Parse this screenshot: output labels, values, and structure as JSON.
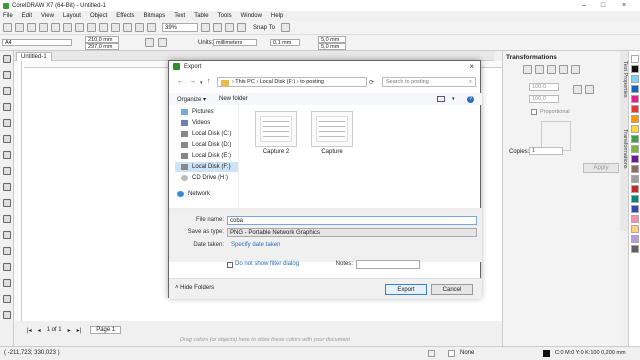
{
  "window": {
    "title": "CorelDRAW X7 (64-Bit) - Untitled-1"
  },
  "menu": [
    "File",
    "Edit",
    "View",
    "Layout",
    "Object",
    "Effects",
    "Bitmaps",
    "Text",
    "Table",
    "Tools",
    "Window",
    "Help"
  ],
  "toolbar": {
    "zoom": "39%",
    "snap": "Snap To"
  },
  "propbar": {
    "paper": "A4",
    "width": "210,0 mm",
    "height": "297,0 mm",
    "units_label": "Units:",
    "units": "millimeters",
    "nudge": "0,1 mm",
    "dup_x": "5,0 mm",
    "dup_y": "5,0 mm"
  },
  "doc": {
    "tab": "Untitled-1",
    "page_pos": "1 of 1",
    "page_tab": "Page 1",
    "hint": "Drag colors (or objects) here to store these colors with your document"
  },
  "status": {
    "coords": "( -211,723; 330,023 )",
    "fill": "None",
    "outline": "C:0 M:0 Y:0 K:100 0,200 mm"
  },
  "docker": {
    "title": "Transformations",
    "x": "100,0",
    "y": "100,0",
    "proportional": "Proportional",
    "copies_label": "Copies:",
    "copies": "1",
    "apply": "Apply",
    "tab1": "Text Properties",
    "tab2": "Transformations"
  },
  "dialog": {
    "title": "Export",
    "path": [
      "This PC",
      "Local Disk (F:)",
      "to posting"
    ],
    "search_placeholder": "Search to posting",
    "organize": "Organize ▾",
    "new_folder": "New folder",
    "nav": [
      "Pictures",
      "Videos",
      "Local Disk (C:)",
      "Local Disk (D:)",
      "Local Disk (E:)",
      "Local Disk (F:)",
      "CD Drive (H:)",
      "Network"
    ],
    "files": [
      "Capture 2",
      "Capture"
    ],
    "file_name_label": "File name:",
    "file_name": "coba",
    "save_type_label": "Save as type:",
    "save_type": "PNG - Portable Network Graphics",
    "date_label": "Date taken:",
    "date_link": "Specify date taken",
    "filter_label": "Do not show filter dialog",
    "notes_label": "Notes:",
    "hide_folders": "Hide Folders",
    "export": "Export",
    "cancel": "Cancel"
  },
  "colors": {
    "accent": "#2f8f2f",
    "selection": "#cce4f7",
    "link": "#2a6ebd"
  }
}
